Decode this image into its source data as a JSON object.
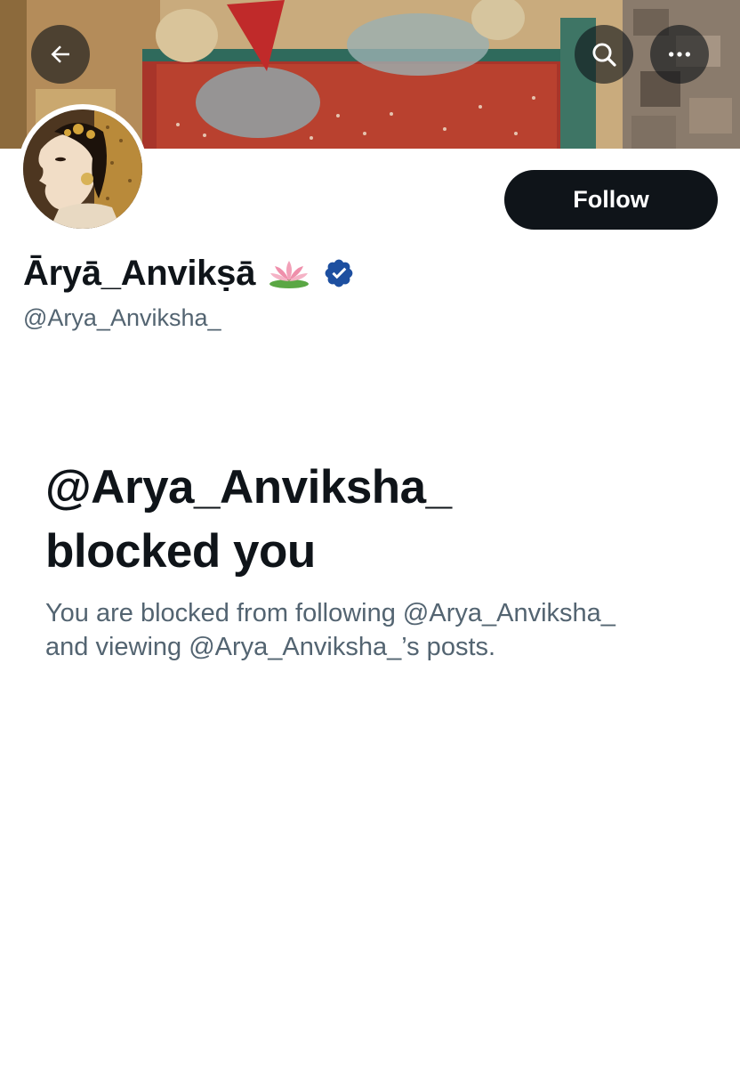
{
  "header": {
    "back_icon": "arrow-left-icon",
    "search_icon": "search-icon",
    "more_icon": "more-horizontal-icon"
  },
  "profile": {
    "display_name": "Āryā_Anvikṣā",
    "handle": "@Arya_Anviksha_",
    "emoji_icon": "lotus-icon",
    "verified_icon": "verified-badge-icon",
    "verified_color": "#1d9bf0"
  },
  "actions": {
    "follow_label": "Follow"
  },
  "blocked": {
    "title_line1": "@Arya_Anviksha_",
    "title_line2": "blocked you",
    "description_line1": "You are blocked from following @Arya_Anviksha_",
    "description_line2": "and viewing @Arya_Anviksha_’s posts."
  },
  "colors": {
    "text_primary": "#0f1419",
    "text_secondary": "#536471",
    "button_dark": "#0f1419"
  }
}
